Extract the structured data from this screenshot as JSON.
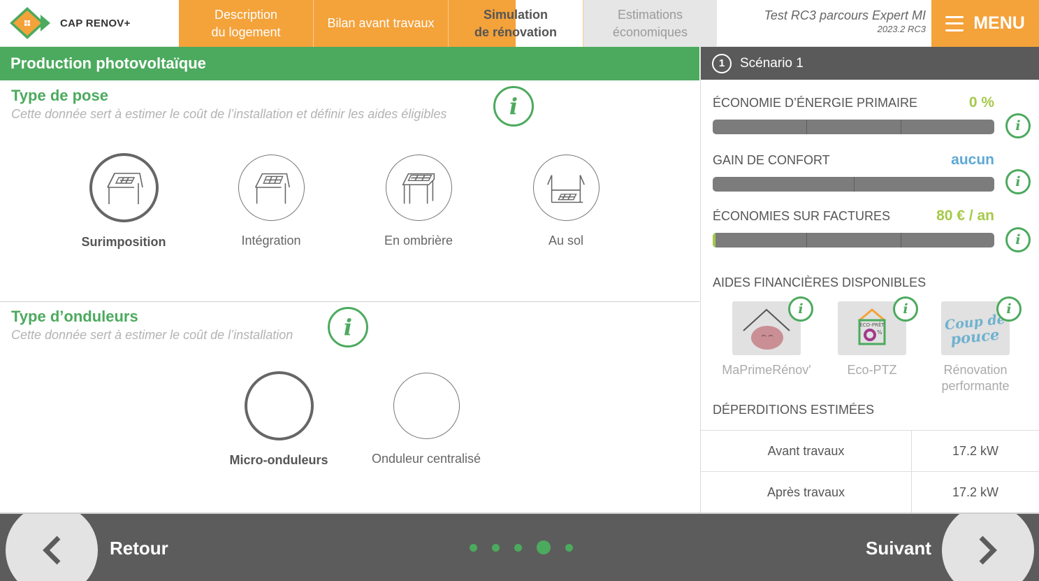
{
  "header": {
    "logo_text": "CAP RENOV+",
    "tabs": [
      {
        "line1": "Description",
        "line2": "du logement"
      },
      {
        "line1": "Bilan avant travaux",
        "line2": ""
      },
      {
        "line1": "Simulation",
        "line2": "de rénovation"
      },
      {
        "line1": "Estimations",
        "line2": "économiques"
      }
    ],
    "project_name": "Test RC3 parcours Expert MI",
    "project_version": "2023.2 RC3",
    "menu_label": "MENU"
  },
  "left": {
    "section_title": "Production photovoltaïque",
    "pose": {
      "title": "Type de pose",
      "subtitle": "Cette donnée sert à estimer le coût de l’installation et définir les aides éligibles",
      "options": [
        {
          "label": "Surimposition",
          "icon": "roof-mounted-panel-icon",
          "selected": true
        },
        {
          "label": "Intégration",
          "icon": "roof-integrated-panel-icon",
          "selected": false
        },
        {
          "label": "En ombrière",
          "icon": "carport-panel-icon",
          "selected": false
        },
        {
          "label": "Au sol",
          "icon": "ground-panel-icon",
          "selected": false
        }
      ]
    },
    "onduleurs": {
      "title": "Type d’onduleurs",
      "subtitle": "Cette donnée sert à estimer le coût de l’installation",
      "options": [
        {
          "label": "Micro-onduleurs",
          "selected": true
        },
        {
          "label": "Onduleur centralisé",
          "selected": false
        }
      ]
    }
  },
  "right": {
    "scenario_number": "1",
    "scenario_label": "Scénario 1",
    "metrics": [
      {
        "label": "ÉCONOMIE D’ÉNERGIE PRIMAIRE",
        "value": "0 %",
        "color": "#a6c94a",
        "segments": 3,
        "fill": 0
      },
      {
        "label": "GAIN DE CONFORT",
        "value": "aucun",
        "color": "#5ea8d6",
        "segments": 2,
        "fill": 0
      },
      {
        "label": "ÉCONOMIES SUR FACTURES",
        "value": "80 € / an",
        "color": "#a6c94a",
        "segments": 3,
        "fill": 0.01
      }
    ],
    "aides_title": "AIDES FINANCIÈRES DISPONIBLES",
    "aides": [
      {
        "line1": "MaPrimeRénov'",
        "line2": ""
      },
      {
        "line1": "Eco-PTZ",
        "line2": ""
      },
      {
        "line1": "Rénovation",
        "line2": "performante"
      }
    ],
    "ecoptz_logo_text": "ÉCO-PRÊT",
    "coup_de_pouce_text": "Coup de pouce",
    "deperditions_title": "DÉPERDITIONS ESTIMÉES",
    "deperditions": [
      {
        "label": "Avant travaux",
        "value": "17.2 kW"
      },
      {
        "label": "Après travaux",
        "value": "17.2 kW"
      }
    ]
  },
  "footer": {
    "back_label": "Retour",
    "next_label": "Suivant",
    "steps_total": 5,
    "current_step": 4
  },
  "colors": {
    "orange": "#f4a23a",
    "green": "#4caa5e",
    "dark_gray": "#5c5c5c"
  }
}
